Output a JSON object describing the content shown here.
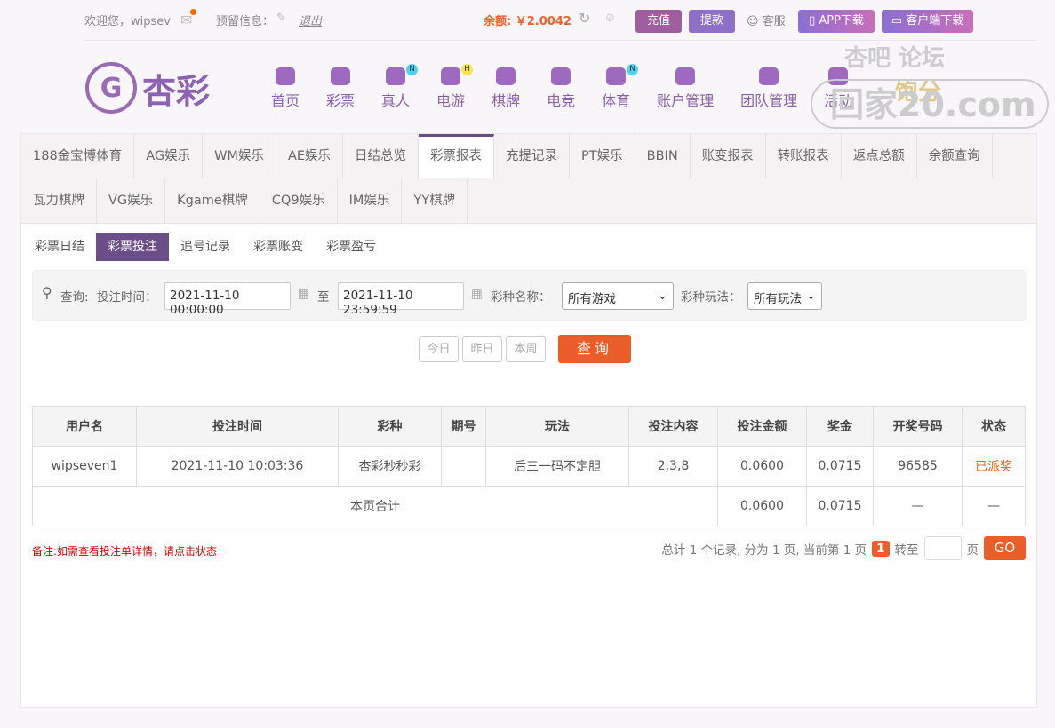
{
  "top": {
    "welcome": "欢迎您，wipsev",
    "reserve": "预留信息：",
    "logout": "退出",
    "balance": "余额: ￥2.0042",
    "recharge": "充值",
    "withdraw": "提款",
    "service": "客服",
    "app": "APP下载",
    "client": "客户端下载"
  },
  "logo": {
    "text": "杏彩"
  },
  "nav": [
    {
      "label": "首页"
    },
    {
      "label": "彩票"
    },
    {
      "label": "真人",
      "badge": "N"
    },
    {
      "label": "电游",
      "badge": "H"
    },
    {
      "label": "棋牌"
    },
    {
      "label": "电竞"
    },
    {
      "label": "体育",
      "badge": "N"
    },
    {
      "label": "账户管理"
    },
    {
      "label": "团队管理"
    },
    {
      "label": "活动"
    }
  ],
  "watermark": {
    "line1": "杏吧 论坛",
    "line2": "回家20.com",
    "mark": "饱分"
  },
  "tabs": [
    "188金宝博体育",
    "AG娱乐",
    "WM娱乐",
    "AE娱乐",
    "日结总览",
    "彩票报表",
    "充提记录",
    "PT娱乐",
    "BBIN",
    "账变报表",
    "转账报表",
    "返点总额",
    "余额查询",
    "瓦力棋牌",
    "VG娱乐",
    "Kgame棋牌",
    "CQ9娱乐",
    "IM娱乐",
    "YY棋牌"
  ],
  "active_tab": "彩票报表",
  "subtabs": [
    "彩票日结",
    "彩票投注",
    "追号记录",
    "彩票账变",
    "彩票盈亏"
  ],
  "active_subtab": "彩票投注",
  "search": {
    "label": "查询:",
    "time_label": "投注时间：",
    "start": "2021-11-10 00:00:00",
    "to": "至",
    "end": "2021-11-10 23:59:59",
    "game_label": "彩种名称：",
    "game": "所有游戏",
    "play_label": "彩种玩法：",
    "play": "所有玩法"
  },
  "quick": {
    "today": "今日",
    "yesterday": "昨日",
    "week": "本周",
    "query": "查询"
  },
  "table": {
    "headers": [
      "用户名",
      "投注时间",
      "彩种",
      "期号",
      "玩法",
      "投注内容",
      "投注金额",
      "奖金",
      "开奖号码",
      "状态"
    ],
    "rows": [
      [
        "wipseven1",
        "2021-11-10 10:03:36",
        "杏彩秒秒彩",
        "",
        "后三一码不定胆",
        "2,3,8",
        "0.0600",
        "0.0715",
        "96585",
        "已派奖"
      ]
    ],
    "total": {
      "label": "本页合计",
      "amount": "0.0600",
      "bonus": "0.0715",
      "draw": "—",
      "status": "—"
    }
  },
  "note": "备注:如需查看投注单详情，请点击状态",
  "pager": {
    "summary": "总计 1 个记录, 分为 1 页, 当前第 1 页",
    "page": "1",
    "goto": "转至",
    "unit": "页",
    "go": "GO"
  }
}
